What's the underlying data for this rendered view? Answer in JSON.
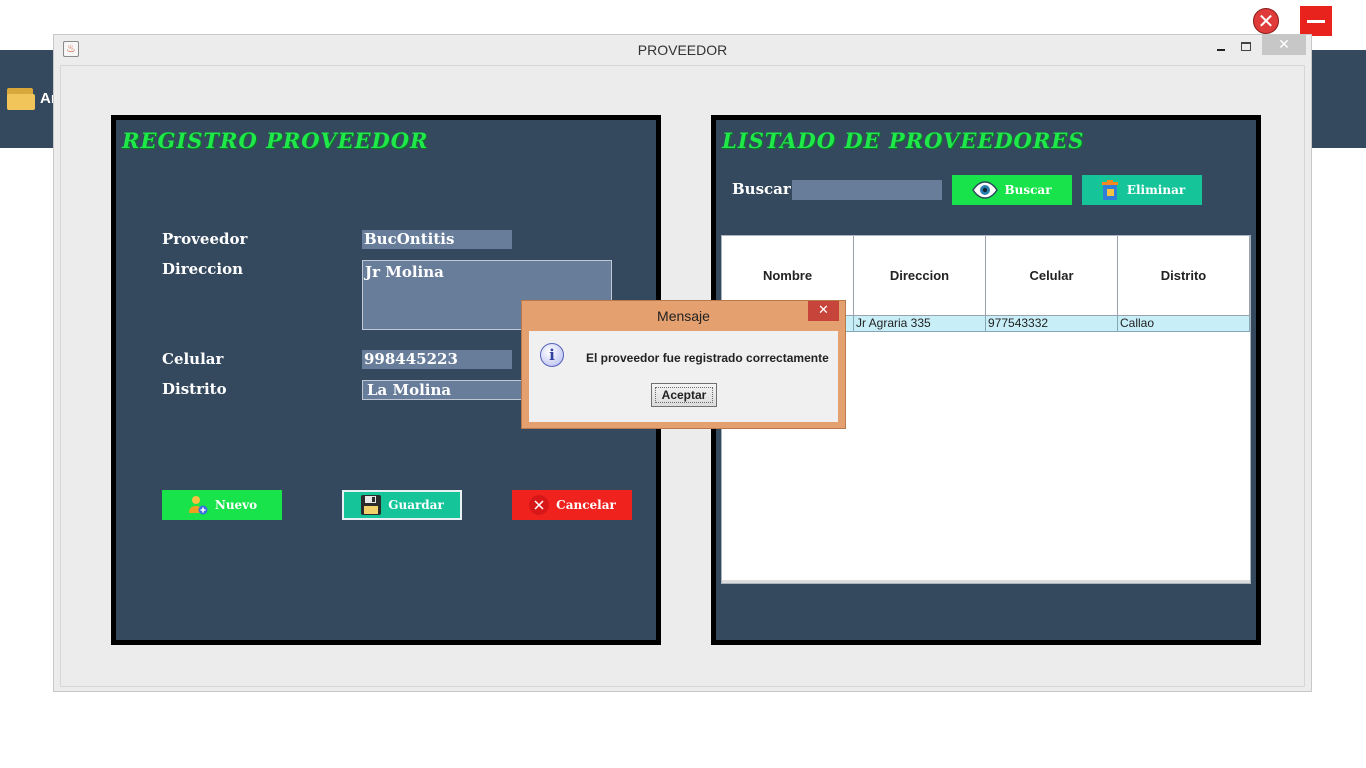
{
  "background_app": {
    "label": "Ar"
  },
  "window": {
    "title": "PROVEEDOR",
    "close_glyph": "✕"
  },
  "registro": {
    "title": "REGISTRO PROVEEDOR",
    "labels": {
      "proveedor": "Proveedor",
      "direccion": "Direccion",
      "celular": "Celular",
      "distrito": "Distrito"
    },
    "values": {
      "proveedor": "BucOntitis",
      "direccion": "Jr Molina",
      "celular": "998445223",
      "distrito": "La Molina"
    },
    "buttons": {
      "nuevo": "Nuevo",
      "guardar": "Guardar",
      "cancelar": "Cancelar"
    }
  },
  "listado": {
    "title": "LISTADO DE PROVEEDORES",
    "buscar_label": "Buscar:",
    "buscar_value": "",
    "buttons": {
      "buscar": "Buscar",
      "eliminar": "Eliminar"
    },
    "table": {
      "columns": [
        "Nombre",
        "Direccion",
        "Celular",
        "Distrito"
      ],
      "rows": [
        [
          "",
          "Jr Agraria 335",
          "977543332",
          "Callao"
        ]
      ]
    }
  },
  "dialog": {
    "title": "Mensaje",
    "message": "El proveedor fue registrado correctamente",
    "ok_label": "Aceptar",
    "close_glyph": "✕",
    "icon": "info-icon"
  },
  "colors": {
    "panel_bg": "#34495e",
    "title_green": "#1ee84a",
    "field_bg": "#687d9a",
    "nuevo_btn": "#18e34a",
    "guardar_btn": "#16c49a",
    "cancelar_btn": "#f0221d",
    "buscar_btn": "#18e34a",
    "eliminar_btn": "#16c49a",
    "dialog_frame": "#e4a06e",
    "selected_row": "#c8eef8"
  }
}
